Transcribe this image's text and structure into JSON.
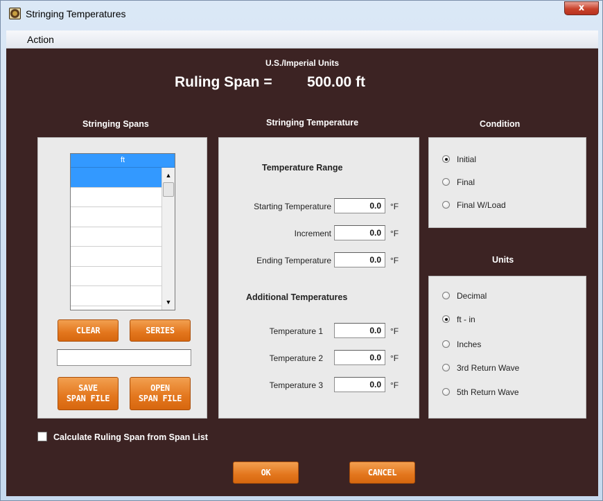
{
  "window": {
    "title": "Stringing Temperatures",
    "close_glyph": "x"
  },
  "icons": {
    "app": "app-globe-icon",
    "close": "close-icon",
    "scroll_up": "arrow-up-icon",
    "scroll_down": "arrow-down-icon"
  },
  "menu": {
    "items": [
      "Action"
    ]
  },
  "header": {
    "units_system": "U.S./Imperial Units",
    "ruling_span_label": "Ruling Span =",
    "ruling_span_value": "500.00 ft"
  },
  "spans": {
    "title": "Stringing Spans",
    "column_header": "ft",
    "rows": [
      "",
      "",
      "",
      "",
      "",
      "",
      ""
    ],
    "clear_label": "CLEAR",
    "series_label": "SERIES",
    "entry_value": "",
    "save_label_1": "SAVE",
    "save_label_2": "SPAN FILE",
    "open_label_1": "OPEN",
    "open_label_2": "SPAN FILE"
  },
  "temperature": {
    "title": "Stringing Temperature",
    "range_title": "Temperature Range",
    "starting_label": "Starting Temperature",
    "starting_value": "0.0",
    "increment_label": "Increment",
    "increment_value": "0.0",
    "ending_label": "Ending Temperature",
    "ending_value": "0.0",
    "additional_title": "Additional Temperatures",
    "t1_label": "Temperature 1",
    "t1_value": "0.0",
    "t2_label": "Temperature 2",
    "t2_value": "0.0",
    "t3_label": "Temperature 3",
    "t3_value": "0.0",
    "unit": "°F"
  },
  "condition": {
    "title": "Condition",
    "options": [
      "Initial",
      "Final",
      "Final W/Load"
    ],
    "selected": "Initial"
  },
  "units": {
    "title": "Units",
    "options": [
      "Decimal",
      "ft - in",
      "Inches",
      "3rd Return Wave",
      "5th Return Wave"
    ],
    "selected": "ft - in"
  },
  "calc_checkbox": {
    "label": "Calculate Ruling Span from Span List",
    "checked": false
  },
  "footer": {
    "ok_label": "OK",
    "cancel_label": "CANCEL"
  },
  "colors": {
    "background": "#3c2323",
    "panel": "#eaeaea",
    "accent_orange": "#e3761d",
    "selection_blue": "#3399ff"
  }
}
